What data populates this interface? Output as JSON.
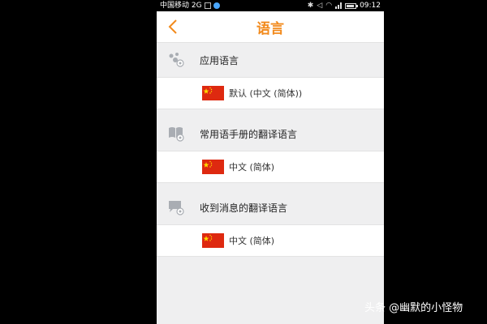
{
  "status_bar": {
    "carrier": "中国移动 2G",
    "time": "09:12"
  },
  "header": {
    "title": "语言",
    "back_icon": "chevron-left-icon"
  },
  "sections": [
    {
      "icon": "app-language-icon",
      "label": "应用语言",
      "flag": "china-flag-icon",
      "value": "默认 (中文 (简体))"
    },
    {
      "icon": "phrasebook-icon",
      "label": "常用语手册的翻译语言",
      "flag": "china-flag-icon",
      "value": "中文 (简体)"
    },
    {
      "icon": "chat-bubble-icon",
      "label": "收到消息的翻译语言",
      "flag": "china-flag-icon",
      "value": "中文 (简体)"
    }
  ],
  "colors": {
    "accent": "#f28a1c",
    "background": "#efeff0",
    "row": "#ffffff"
  },
  "watermark": "头条 @幽默的小怪物"
}
